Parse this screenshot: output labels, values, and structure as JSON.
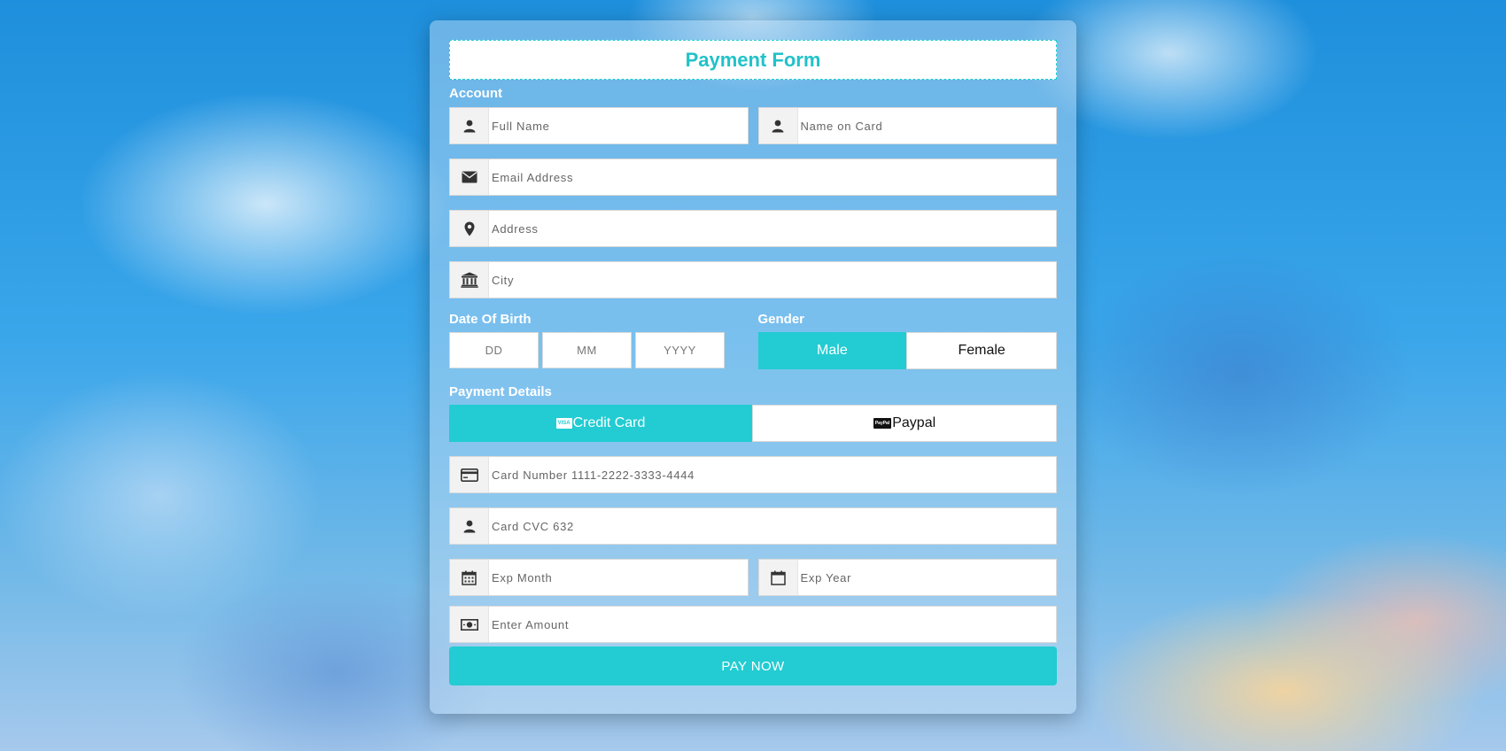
{
  "form": {
    "title": "Payment Form",
    "sections": {
      "account": "Account",
      "date_of_birth": "Date Of Birth",
      "gender": "Gender",
      "payment_details": "Payment Details"
    },
    "fields": {
      "full_name": "Full Name",
      "name_on_card": "Name on Card",
      "email": "Email Address",
      "address": "Address",
      "city": "City",
      "dob_dd": "DD",
      "dob_mm": "MM",
      "dob_yyyy": "YYYY",
      "card_number": "Card Number 1111-2222-3333-4444",
      "card_cvc": "Card CVC 632",
      "exp_month": "Exp Month",
      "exp_year": "Exp Year",
      "amount": "Enter Amount"
    },
    "gender_options": {
      "male": "Male",
      "female": "Female",
      "selected": "Male"
    },
    "payment_methods": {
      "credit_card": "Credit Card",
      "credit_card_badge": "VISA",
      "paypal": "Paypal",
      "paypal_badge": "PayPal",
      "selected": "Credit Card"
    },
    "submit_label": "PAY NOW"
  },
  "colors": {
    "accent": "#22ccd2",
    "title": "#21c2c9",
    "icon": "#333333"
  },
  "icons": {
    "full_name": "user-icon",
    "name_on_card": "user-icon",
    "email": "envelope-icon",
    "address": "map-marker-icon",
    "city": "bank-icon",
    "card_number": "credit-card-icon",
    "card_cvc": "user-icon",
    "exp_month": "calendar-icon",
    "exp_year": "calendar-icon",
    "amount": "money-icon"
  }
}
